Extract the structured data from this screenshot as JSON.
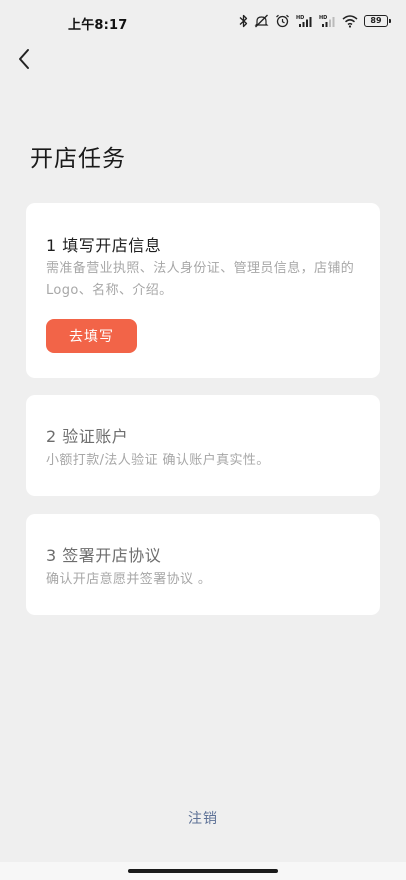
{
  "status_bar": {
    "time": "上午8:17",
    "battery": "89",
    "icons": [
      "bluetooth-icon",
      "mute-icon",
      "alarm-icon",
      "signal-hd-icon",
      "signal-hd-icon",
      "wifi-icon",
      "battery-icon"
    ]
  },
  "header": {
    "back_icon": "chevron-left-icon",
    "title": "开店任务"
  },
  "tasks": [
    {
      "title": "1 填写开店信息",
      "desc": "需准备营业执照、法人身份证、管理员信息，店铺的Logo、名称、介绍。",
      "button_label": "去填写",
      "active": true
    },
    {
      "title": "2 验证账户",
      "desc": "小额打款/法人验证 确认账户真实性。",
      "active": false
    },
    {
      "title": "3 签署开店协议",
      "desc": "确认开店意愿并签署协议 。",
      "active": false
    }
  ],
  "footer": {
    "logout_label": "注销"
  },
  "colors": {
    "accent": "#f26448",
    "link": "#5d7196",
    "background": "#efefef",
    "card": "#ffffff"
  }
}
